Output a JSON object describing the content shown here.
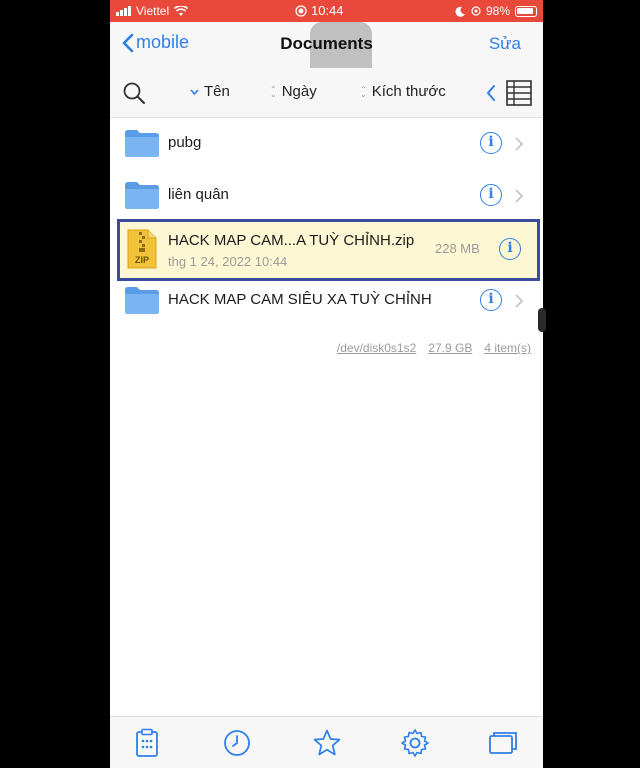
{
  "status_bar": {
    "carrier": "Viettel",
    "time": "10:44",
    "battery": "98%"
  },
  "nav": {
    "back_label": "mobile",
    "title": "Documents",
    "edit_label": "Sửa"
  },
  "sort_bar": {
    "name_label": "Tên",
    "date_label": "Ngày",
    "size_label": "Kích thước"
  },
  "files": [
    {
      "name": "pubg",
      "type": "folder"
    },
    {
      "name": "liên quân",
      "type": "folder"
    },
    {
      "name": "HACK MAP CAM...A TUỲ CHỈNH.zip",
      "type": "zip",
      "date": "thg 1 24, 2022 10:44",
      "size": "228 MB"
    },
    {
      "name": "HACK MAP CAM SIÊU XA TUỲ CHỈNH",
      "type": "folder"
    }
  ],
  "footer": {
    "device": "/dev/disk0s1s2",
    "capacity": "27.9 GB",
    "count": "4 item(s)"
  },
  "colors": {
    "accent": "#2f7fe6",
    "status_bar": "#e8493b",
    "highlight_bg": "#fdf7d3",
    "highlight_border": "#3c4aa0"
  },
  "tab_bar": [
    "clipboard-icon",
    "clock-icon",
    "star-icon",
    "gear-icon",
    "windows-icon"
  ]
}
